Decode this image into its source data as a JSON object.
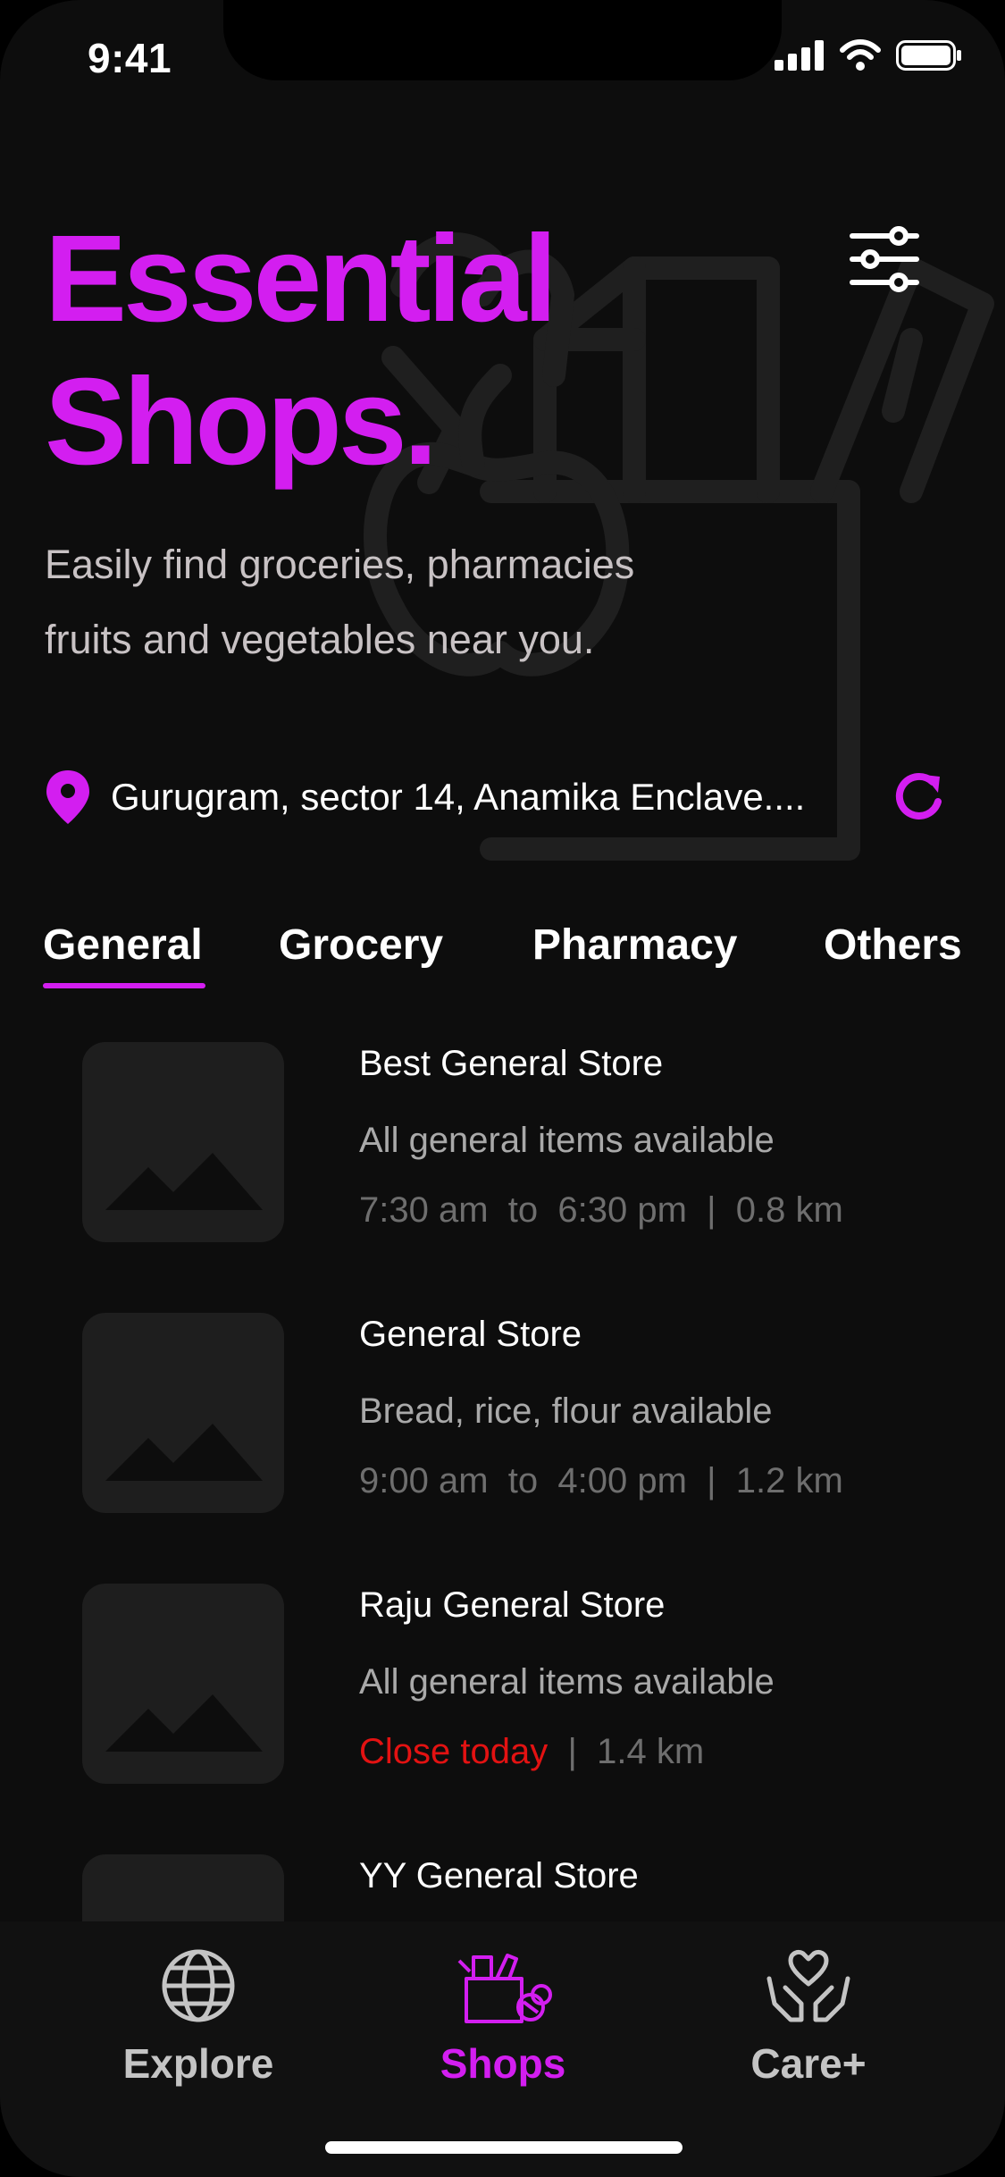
{
  "status": {
    "time": "9:41"
  },
  "header": {
    "title_line1": "Essential",
    "title_line2": "Shops.",
    "subtitle_line1": "Easily find groceries, pharmacies",
    "subtitle_line2": "fruits and vegetables near you."
  },
  "location": {
    "address": "Gurugram, sector 14, Anamika Enclave...."
  },
  "tabs": [
    {
      "label": "General",
      "active": true
    },
    {
      "label": "Grocery",
      "active": false
    },
    {
      "label": "Pharmacy",
      "active": false
    },
    {
      "label": "Others",
      "active": false
    }
  ],
  "shops": [
    {
      "name": "Best General Store",
      "desc": "All general items available",
      "open": "7:30 am",
      "to": "to",
      "close": "6:30 pm",
      "sep": "|",
      "distance": "0.8 km"
    },
    {
      "name": "General Store",
      "desc": "Bread, rice, flour available",
      "open": "9:00 am",
      "to": "to",
      "close": "4:00 pm",
      "sep": "|",
      "distance": "1.2 km"
    },
    {
      "name": "Raju General Store",
      "desc": "All general items available",
      "status": "Close today",
      "sep": "|",
      "distance": "1.4 km"
    },
    {
      "name": "YY General Store"
    }
  ],
  "nav": [
    {
      "label": "Explore",
      "icon": "globe-icon",
      "active": false
    },
    {
      "label": "Shops",
      "icon": "shopping-bag-icon",
      "active": true
    },
    {
      "label": "Care+",
      "icon": "heart-hands-icon",
      "active": false
    }
  ],
  "colors": {
    "accent": "#d31ef0",
    "background": "#0d0d0d",
    "closed": "#e31212"
  }
}
